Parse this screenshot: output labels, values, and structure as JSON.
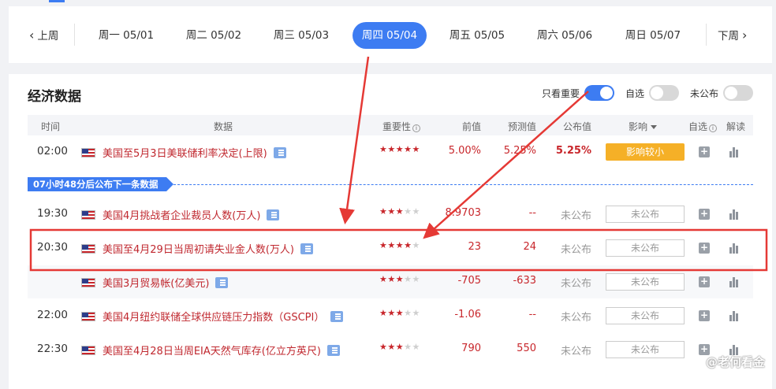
{
  "week": {
    "prev_label": "上周",
    "next_label": "下周",
    "days": [
      {
        "label": "周一 05/01"
      },
      {
        "label": "周二 05/02"
      },
      {
        "label": "周三 05/03"
      },
      {
        "label": "周四 05/04",
        "active": true
      },
      {
        "label": "周五 05/05"
      },
      {
        "label": "周六 05/06"
      },
      {
        "label": "周日 05/07"
      }
    ]
  },
  "panel": {
    "title": "经济数据",
    "filters": {
      "important_only": "只看重要",
      "favorites": "自选",
      "unpublished": "未公布"
    }
  },
  "table": {
    "headers": {
      "time": "时间",
      "data": "数据",
      "importance": "重要性",
      "previous": "前值",
      "forecast": "预测值",
      "actual": "公布值",
      "impact": "影响",
      "favorite": "自选",
      "analysis": "解读"
    },
    "countdown": "07小时48分后公布下一条数据",
    "rows": [
      {
        "time": "02:00",
        "name": "美国至5月3日美联储利率决定(上限)",
        "stars": 5,
        "previous": "5.00%",
        "forecast": "5.25%",
        "actual": "5.25%",
        "impact": "影响较小"
      },
      {
        "time": "19:30",
        "name": "美国4月挑战者企业裁员人数(万人)",
        "stars": 3,
        "previous": "8.9703",
        "forecast": "--",
        "actual": "未公布",
        "impact": "未公布"
      },
      {
        "time": "20:30",
        "name": "美国至4月29日当周初请失业金人数(万人)",
        "stars": 4,
        "previous": "23",
        "forecast": "24",
        "actual": "未公布",
        "impact": "未公布"
      },
      {
        "time": "",
        "name": "美国3月贸易帐(亿美元)",
        "stars": 3,
        "previous": "-705",
        "forecast": "-633",
        "actual": "未公布",
        "impact": "未公布"
      },
      {
        "time": "22:00",
        "name": "美国4月纽约联储全球供应链压力指数（GSCPI）",
        "stars": 3,
        "previous": "-1.06",
        "forecast": "--",
        "actual": "未公布",
        "impact": "未公布"
      },
      {
        "time": "22:30",
        "name": "美国至4月28日当周EIA天然气库存(亿立方英尺)",
        "stars": 3,
        "previous": "790",
        "forecast": "550",
        "actual": "未公布",
        "impact": "未公布"
      }
    ]
  },
  "watermark": "@老何看金",
  "colors": {
    "accent": "#3d7cf2",
    "red": "#c8262b",
    "impact_badge": "#f5b027",
    "annotation": "#e53935"
  }
}
